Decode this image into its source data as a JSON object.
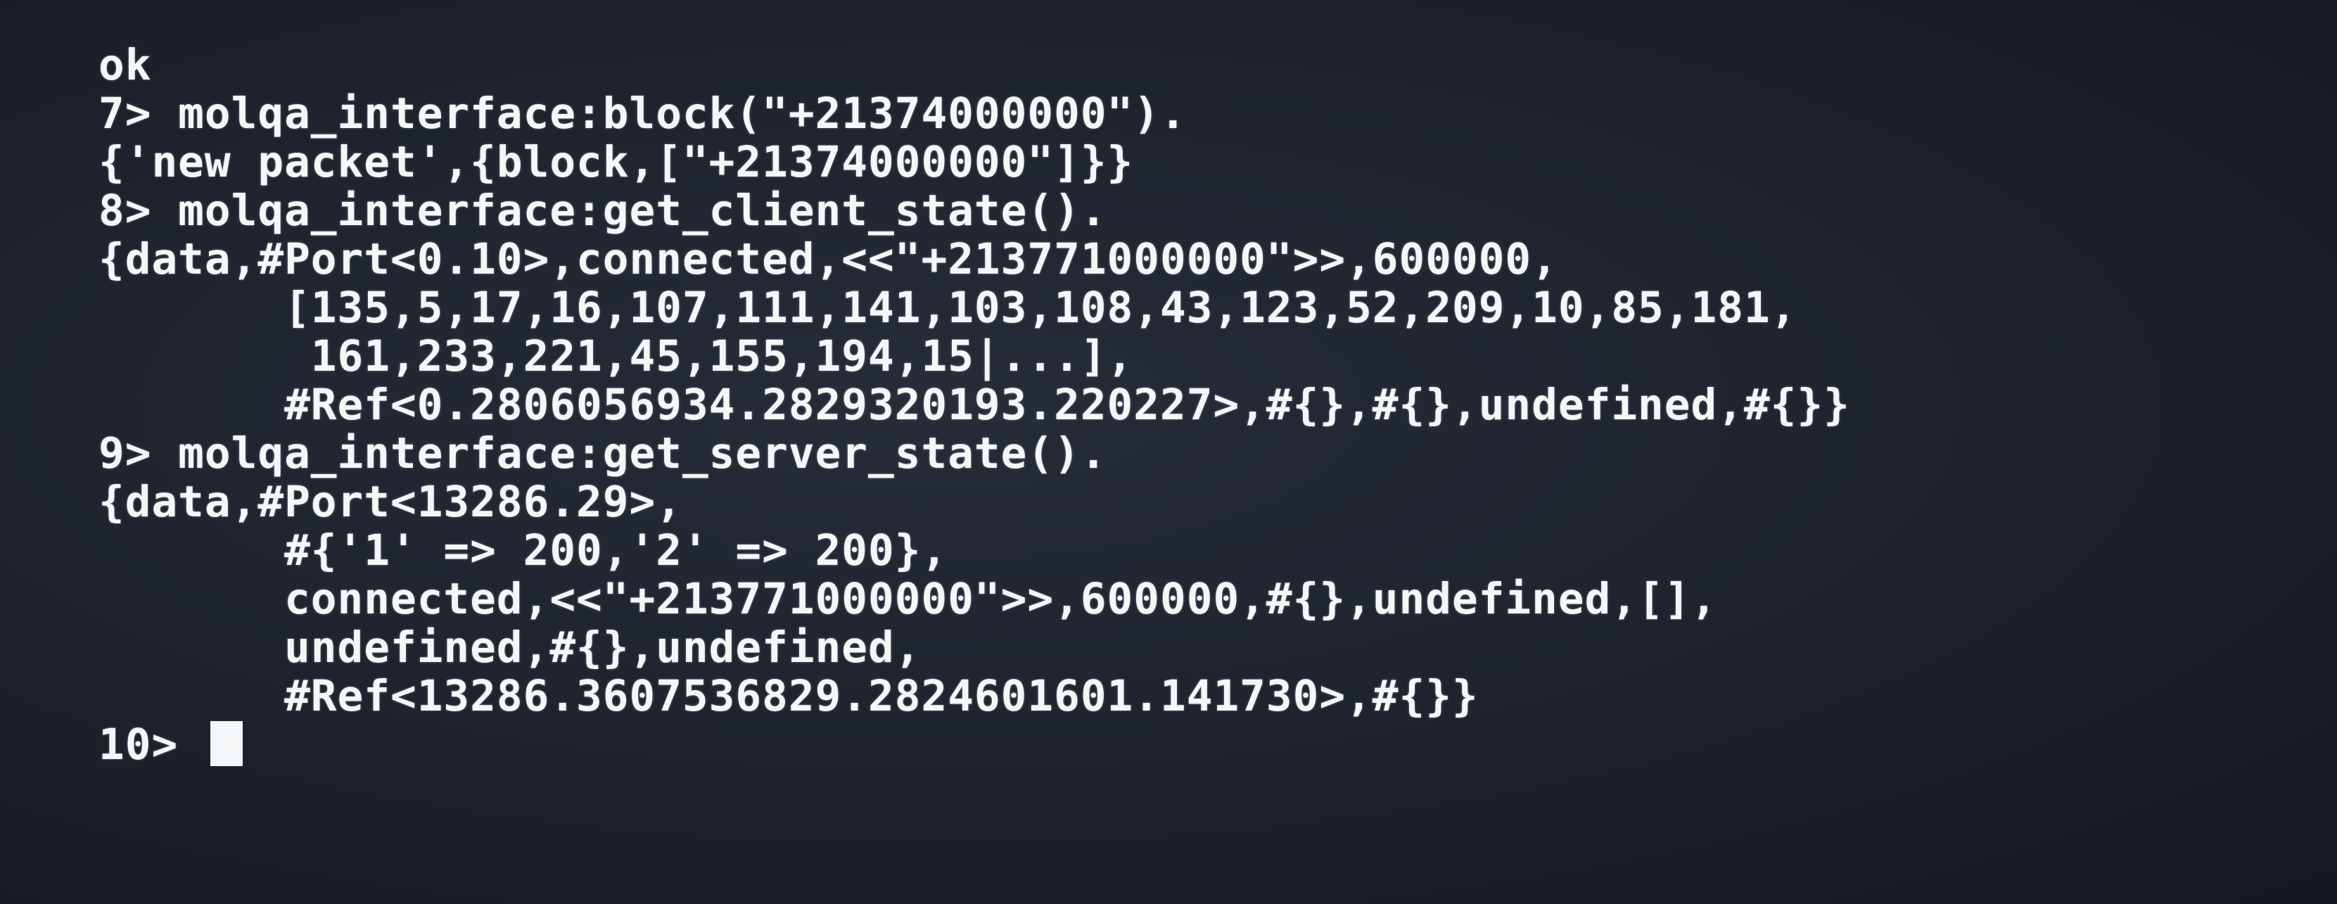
{
  "terminal": {
    "lines": [
      "ok",
      "7> molqa_interface:block(\"+21374000000\").",
      "{'new packet',{block,[\"+21374000000\"]}}",
      "8> molqa_interface:get_client_state().",
      "{data,#Port<0.10>,connected,<<\"+213771000000\">>,600000,",
      "       [135,5,17,16,107,111,141,103,108,43,123,52,209,10,85,181,",
      "        161,233,221,45,155,194,15|...],",
      "       #Ref<0.2806056934.2829320193.220227>,#{},#{},undefined,#{}}",
      "9> molqa_interface:get_server_state().",
      "{data,#Port<13286.29>,",
      "       #{'1' => 200,'2' => 200},",
      "       connected,<<\"+213771000000\">>,600000,#{},undefined,[],",
      "       undefined,#{},undefined,",
      "       #Ref<13286.3607536829.2824601601.141730>,#{}}"
    ],
    "prompt": "10> "
  }
}
